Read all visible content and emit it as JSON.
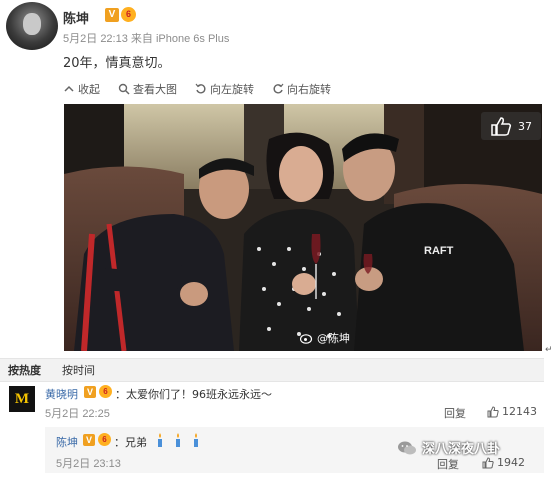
{
  "post": {
    "author": "陈坤",
    "vip_badge": "V",
    "level_badge": "6",
    "date": "5月2日",
    "time": "22:13",
    "source_prefix": "来自",
    "source": "iPhone 6s Plus",
    "text": "20年，情真意切。"
  },
  "toolbar": {
    "collapse_label": "收起",
    "view_large_label": "查看大图",
    "rotate_left_label": "向左旋转",
    "rotate_right_label": "向右旋转"
  },
  "photo": {
    "like_count": "37",
    "watermark": "@陈坤",
    "shirt_text": "RAFT"
  },
  "sort": {
    "by_hot": "按热度",
    "by_time": "按时间"
  },
  "comment": {
    "avatar_text": "M",
    "author": "黄晓明",
    "text": "：太爱你们了！96班永远永远～",
    "date": "5月2日",
    "time": "22:25",
    "reply_label": "回复",
    "like_count": "12143"
  },
  "reply": {
    "author": "陈坤",
    "text": "：兄弟",
    "date": "5月2日",
    "time": "23:13",
    "reply_label": "回复",
    "like_count": "1942"
  },
  "overlay_watermark": "深八深夜八卦",
  "colors": {
    "link": "#3a6aa8",
    "vip_orange": "#f0a020",
    "meta_gray": "#8c8c8c"
  }
}
